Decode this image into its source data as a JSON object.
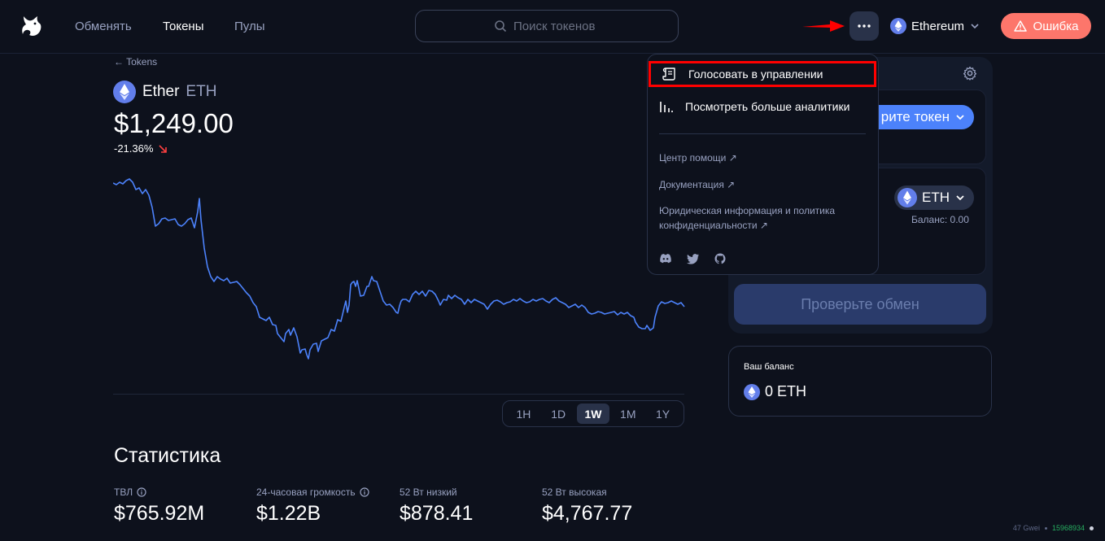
{
  "nav": {
    "links": [
      "Обменять",
      "Токены",
      "Пулы"
    ],
    "active_link": "Токены",
    "search_placeholder": "Поиск токенов",
    "network": "Ethereum",
    "error_label": "Ошибка"
  },
  "token": {
    "back_label": "← Tokens",
    "name": "Ether",
    "symbol": "ETH",
    "price": "$1,249.00",
    "delta": "-21.36%",
    "timeframes": [
      "1H",
      "1D",
      "1W",
      "1M",
      "1Y"
    ],
    "active_timeframe": "1W"
  },
  "stats": {
    "title": "Статистика",
    "items": [
      {
        "label": "ТВЛ",
        "value": "$765.92M"
      },
      {
        "label": "24-часовая громкость",
        "value": "$1.22B"
      },
      {
        "label": "52 Вт низкий",
        "value": "$878.41"
      },
      {
        "label": "52 Вт высокая",
        "value": "$4,767.77"
      }
    ]
  },
  "swap": {
    "select_token_label": "рите токен",
    "output_token": "ETH",
    "balance_label": "Баланс: 0.00",
    "review_label": "Проверьте обмен"
  },
  "balance_card": {
    "title": "Ваш баланс",
    "value": "0 ETH"
  },
  "menu": {
    "governance": "Голосовать в управлении",
    "analytics": "Посмотреть больше аналитики",
    "help": "Центр помощи ↗",
    "docs": "Документация ↗",
    "legal": "Юридическая информация и политика конфиденциальности ↗"
  },
  "footer": {
    "gwei": "47 Gwei",
    "block": "15968934"
  },
  "colors": {
    "accent": "#4c82fb",
    "error": "#fd766b",
    "negative": "#fd4040",
    "highlight": "#ff0000"
  }
}
